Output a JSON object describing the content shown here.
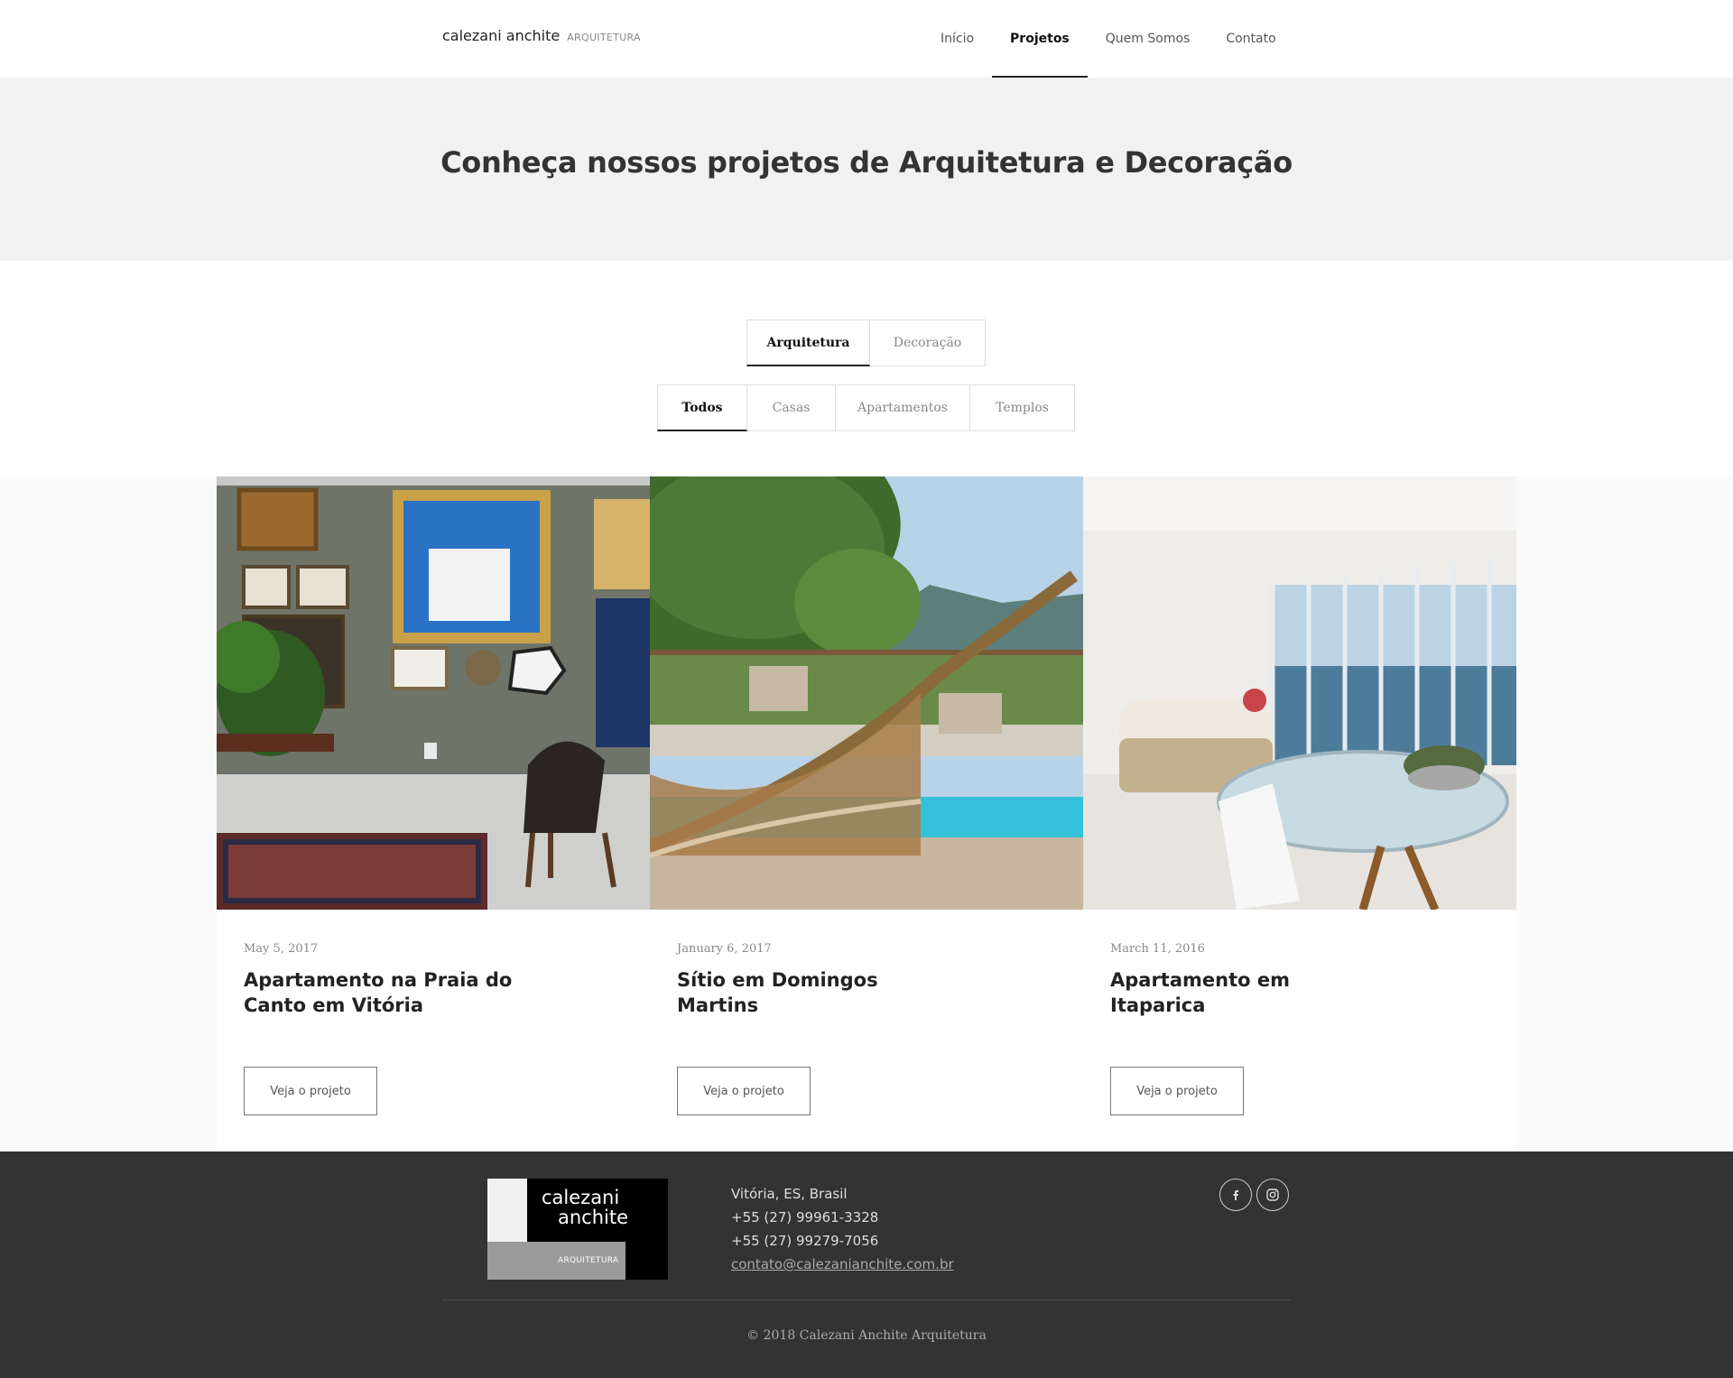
{
  "header": {
    "logo_name": "calezani anchite",
    "logo_sub": "ARQUITETURA",
    "nav": [
      {
        "label": "Início"
      },
      {
        "label": "Projetos",
        "active": true
      },
      {
        "label": "Quem Somos"
      },
      {
        "label": "Contato"
      }
    ]
  },
  "hero": {
    "title": "Conheça nossos projetos de Arquitetura e Decoração"
  },
  "category_tabs": [
    {
      "label": "Arquitetura",
      "active": true
    },
    {
      "label": "Decoração"
    }
  ],
  "filter_tabs": [
    {
      "label": "Todos",
      "active": true
    },
    {
      "label": "Casas"
    },
    {
      "label": "Apartamentos"
    },
    {
      "label": "Templos"
    }
  ],
  "projects": [
    {
      "date": "May 5, 2017",
      "title": "Apartamento na Praia do Canto em Vitória",
      "button": "Veja o projeto"
    },
    {
      "date": "January 6, 2017",
      "title": "Sítio em Domingos Martins",
      "button": "Veja o projeto"
    },
    {
      "date": "March 11, 2016",
      "title": "Apartamento em Itaparica",
      "button": "Veja o projeto"
    }
  ],
  "footer": {
    "logo_line1": "calezani",
    "logo_line2": "anchite",
    "logo_sub": "ARQUITETURA",
    "location": "Vitória, ES, Brasil",
    "phone1": "+55 (27) 99961-3328",
    "phone2": "+55 (27) 99279-7056",
    "email": "contato@calezanianchite.com.br",
    "copyright": "© 2018 Calezani Anchite Arquitetura",
    "social": [
      {
        "icon": "facebook-icon"
      },
      {
        "icon": "instagram-icon"
      }
    ]
  }
}
